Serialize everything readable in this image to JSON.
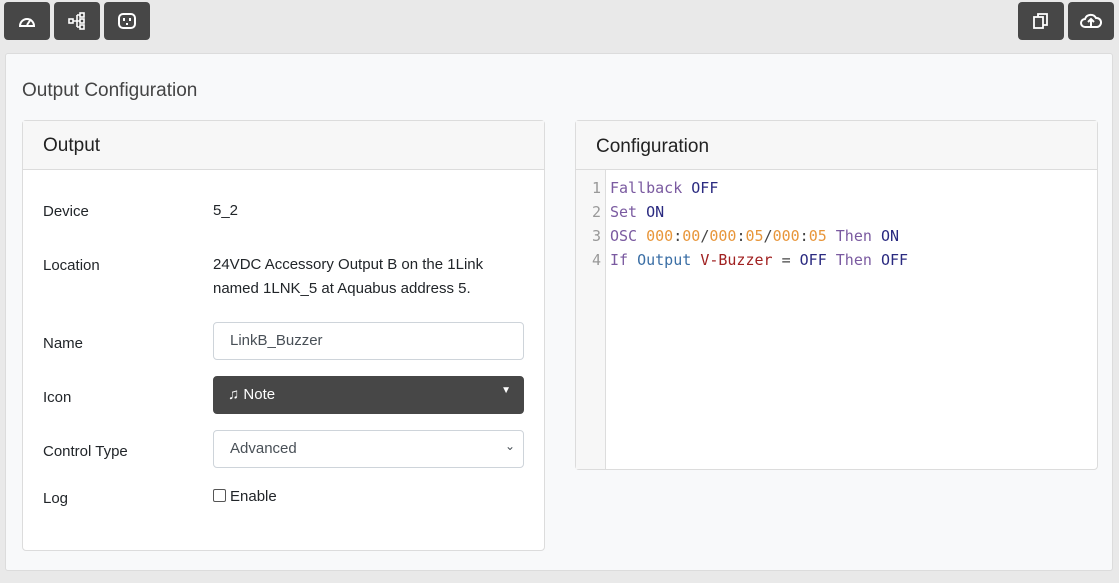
{
  "toolbar": {
    "left": [
      "dashboard-icon",
      "network-tree-icon",
      "outlet-icon"
    ],
    "right": [
      "copy-icon",
      "cloud-upload-icon"
    ]
  },
  "page_title": "Output Configuration",
  "output": {
    "title": "Output",
    "device_label": "Device",
    "device": "5_2",
    "location_label": "Location",
    "location_1": "24VDC Accessory Output B on the 1Link",
    "location_2": "named 1LNK_5 at Aquabus address 5.",
    "name_label": "Name",
    "name": "LinkB_Buzzer",
    "icon_label": "Icon",
    "icon": "Note",
    "control_label": "Control Type",
    "control": "Advanced",
    "log_label": "Log",
    "log_option": "Enable",
    "log_checked": false
  },
  "configuration": {
    "title": "Configuration",
    "line_numbers": [
      "1",
      "2",
      "3",
      "4"
    ],
    "lines": [
      [
        [
          "kw",
          "Fallback "
        ],
        [
          "c",
          "OFF"
        ]
      ],
      [
        [
          "kw",
          "Set "
        ],
        [
          "c",
          "ON"
        ]
      ],
      [
        [
          "kw",
          "OSC "
        ],
        [
          "n",
          "000"
        ],
        [
          "p",
          ":"
        ],
        [
          "n",
          "00"
        ],
        [
          "p",
          "/"
        ],
        [
          "n",
          "000"
        ],
        [
          "p",
          ":"
        ],
        [
          "n",
          "05"
        ],
        [
          "p",
          "/"
        ],
        [
          "n",
          "000"
        ],
        [
          "p",
          ":"
        ],
        [
          "n",
          "05"
        ],
        [
          "kw",
          " Then "
        ],
        [
          "c",
          "ON"
        ]
      ],
      [
        [
          "kw",
          "If "
        ],
        [
          "b",
          "Output "
        ],
        [
          "v",
          "V-Buzzer"
        ],
        [
          "p",
          " = "
        ],
        [
          "c",
          "OFF"
        ],
        [
          "kw",
          " Then "
        ],
        [
          "c",
          "OFF"
        ]
      ]
    ]
  }
}
